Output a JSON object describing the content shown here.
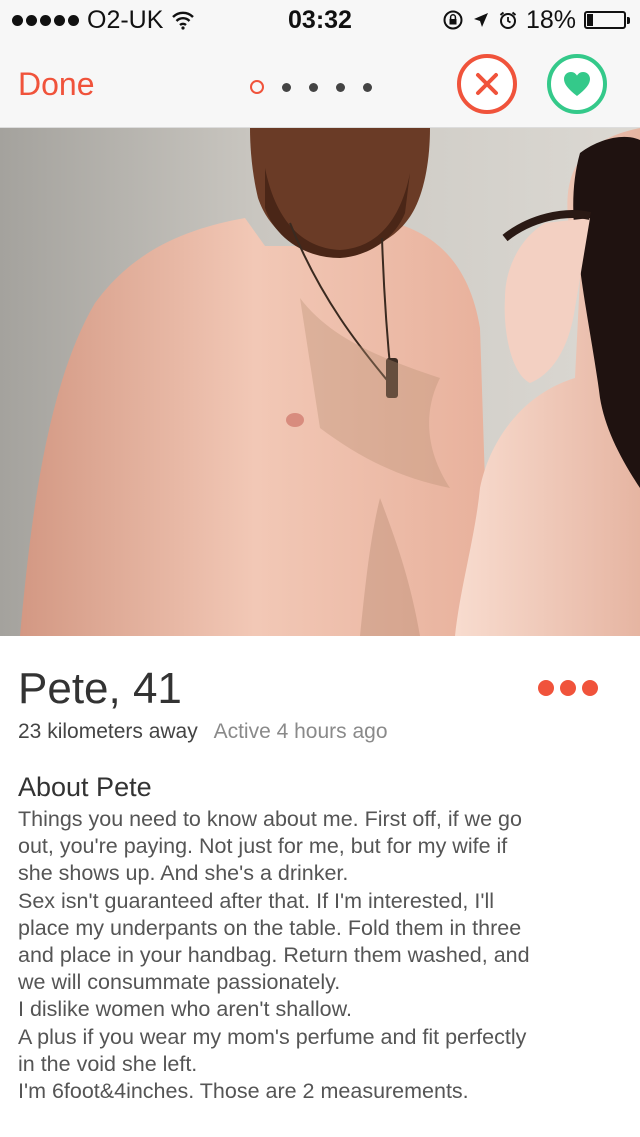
{
  "status_bar": {
    "carrier": "O2-UK",
    "time": "03:32",
    "battery": "18%",
    "battery_level": 0.18
  },
  "nav": {
    "done_label": "Done",
    "page_count": 5,
    "active_page": 0
  },
  "profile": {
    "name_age": "Pete, 41",
    "distance": "23 kilometers away",
    "active": "Active 4 hours ago",
    "about_title": "About Pete",
    "about_lines": [
      "Things you need to know about me. First off, if we go",
      "out, you're paying. Not just for me, but for my wife if",
      "she shows up. And she's a drinker.",
      "Sex isn't guaranteed after that. If I'm interested, I'll",
      "place my underpants on the table. Fold them in three",
      "and place in your handbag. Return them washed, and",
      "we will consummate passionately.",
      "I dislike women who aren't shallow.",
      "A plus if you wear my mom's perfume and fit perfectly",
      "in the void she left.",
      "I'm 6foot&4inches. Those are 2 measurements."
    ]
  },
  "colors": {
    "accent": "#f0533b",
    "like": "#34c98a"
  }
}
